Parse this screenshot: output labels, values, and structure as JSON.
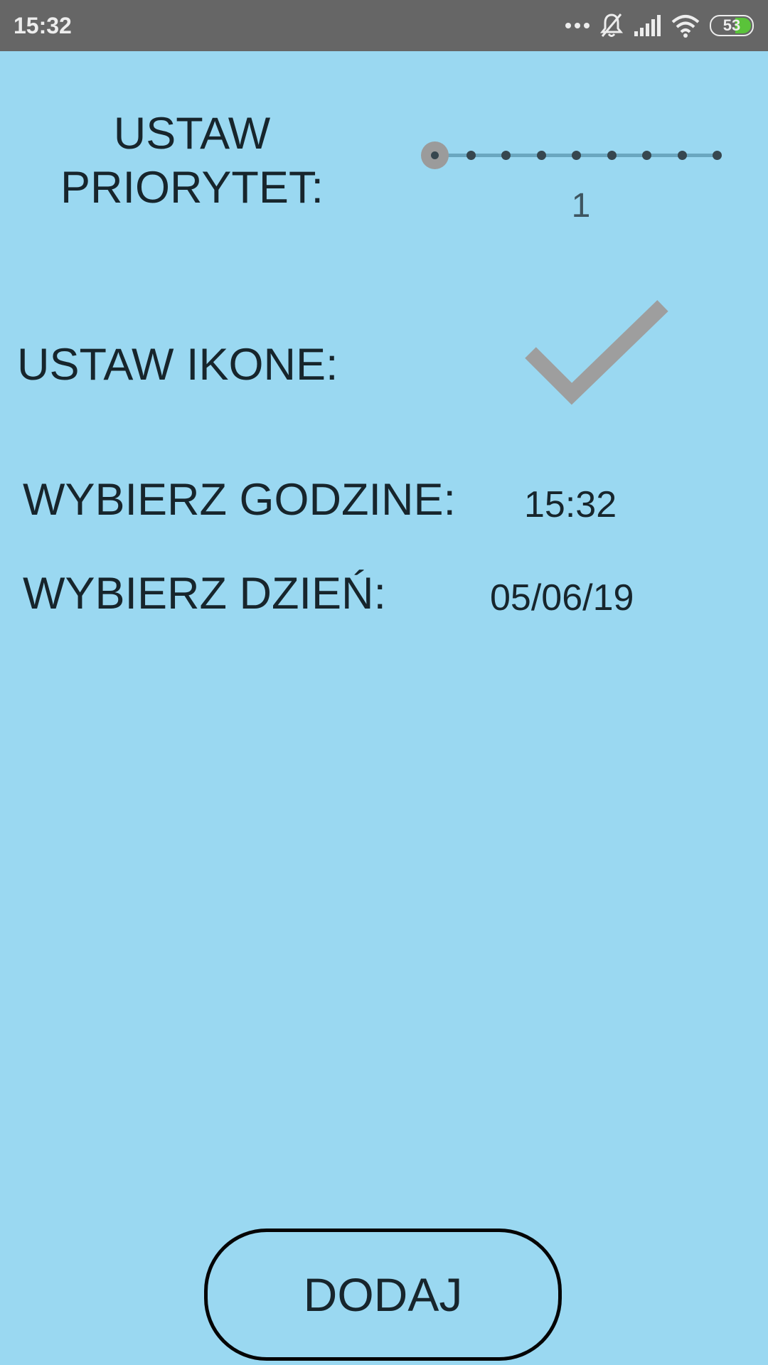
{
  "status_bar": {
    "time": "15:32",
    "battery": "53",
    "icons": [
      "more-dots-icon",
      "bell-off-icon",
      "signal-icon",
      "wifi-icon",
      "battery-icon"
    ],
    "battery_color": "#5ac33a"
  },
  "priority": {
    "label_line1": "USTAW",
    "label_line2": "PRIORYTET:",
    "value": "1",
    "slider": {
      "min": 1,
      "max": 9,
      "current": 1
    }
  },
  "icon_setting": {
    "label": "USTAW IKONE:",
    "icon": "check-icon",
    "icon_color": "#9e9e9e"
  },
  "time_setting": {
    "label": "WYBIERZ GODZINE:",
    "value": "15:32"
  },
  "day_setting": {
    "label": "WYBIERZ DZIEŃ:",
    "value": "05/06/19"
  },
  "add_button": {
    "label": "DODAJ"
  },
  "colors": {
    "background": "#9ad8f1",
    "status_bar": "#666666",
    "text": "#17252c"
  }
}
